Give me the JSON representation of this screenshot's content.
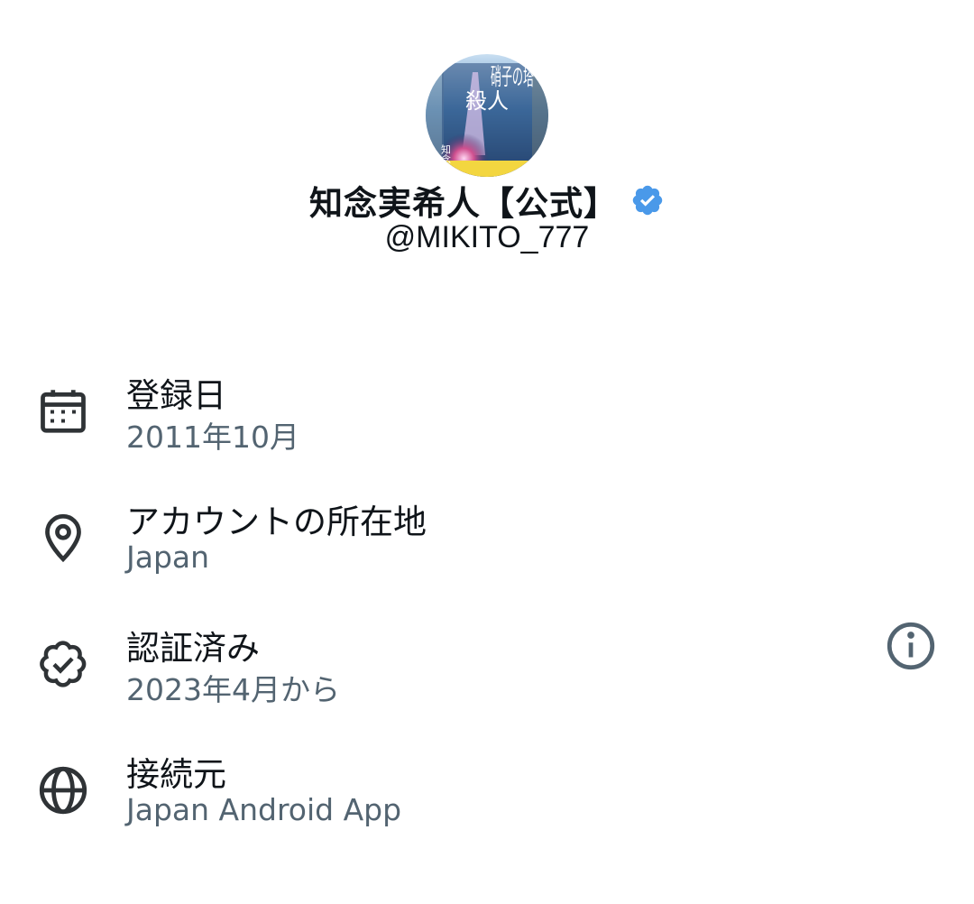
{
  "profile": {
    "display_name": "知念実希人【公式】",
    "handle": "@MIKITO_777",
    "verified_color": "#4a99e9",
    "avatar_text_line1": "硝子の塔",
    "avatar_text_line2": "殺人",
    "avatar_text_line3": "知念実希人"
  },
  "details": [
    {
      "icon": "calendar-icon",
      "title": "登録日",
      "value": "2011年10月"
    },
    {
      "icon": "location-pin-icon",
      "title": "アカウントの所在地",
      "value": "Japan"
    },
    {
      "icon": "verified-badge-icon",
      "title": "認証済み",
      "value": "2023年4月から"
    },
    {
      "icon": "globe-icon",
      "title": "接続元",
      "value": "Japan Android App"
    }
  ],
  "colors": {
    "text_primary": "#0f1419",
    "text_secondary": "#536471",
    "icon": "#2f3336"
  }
}
